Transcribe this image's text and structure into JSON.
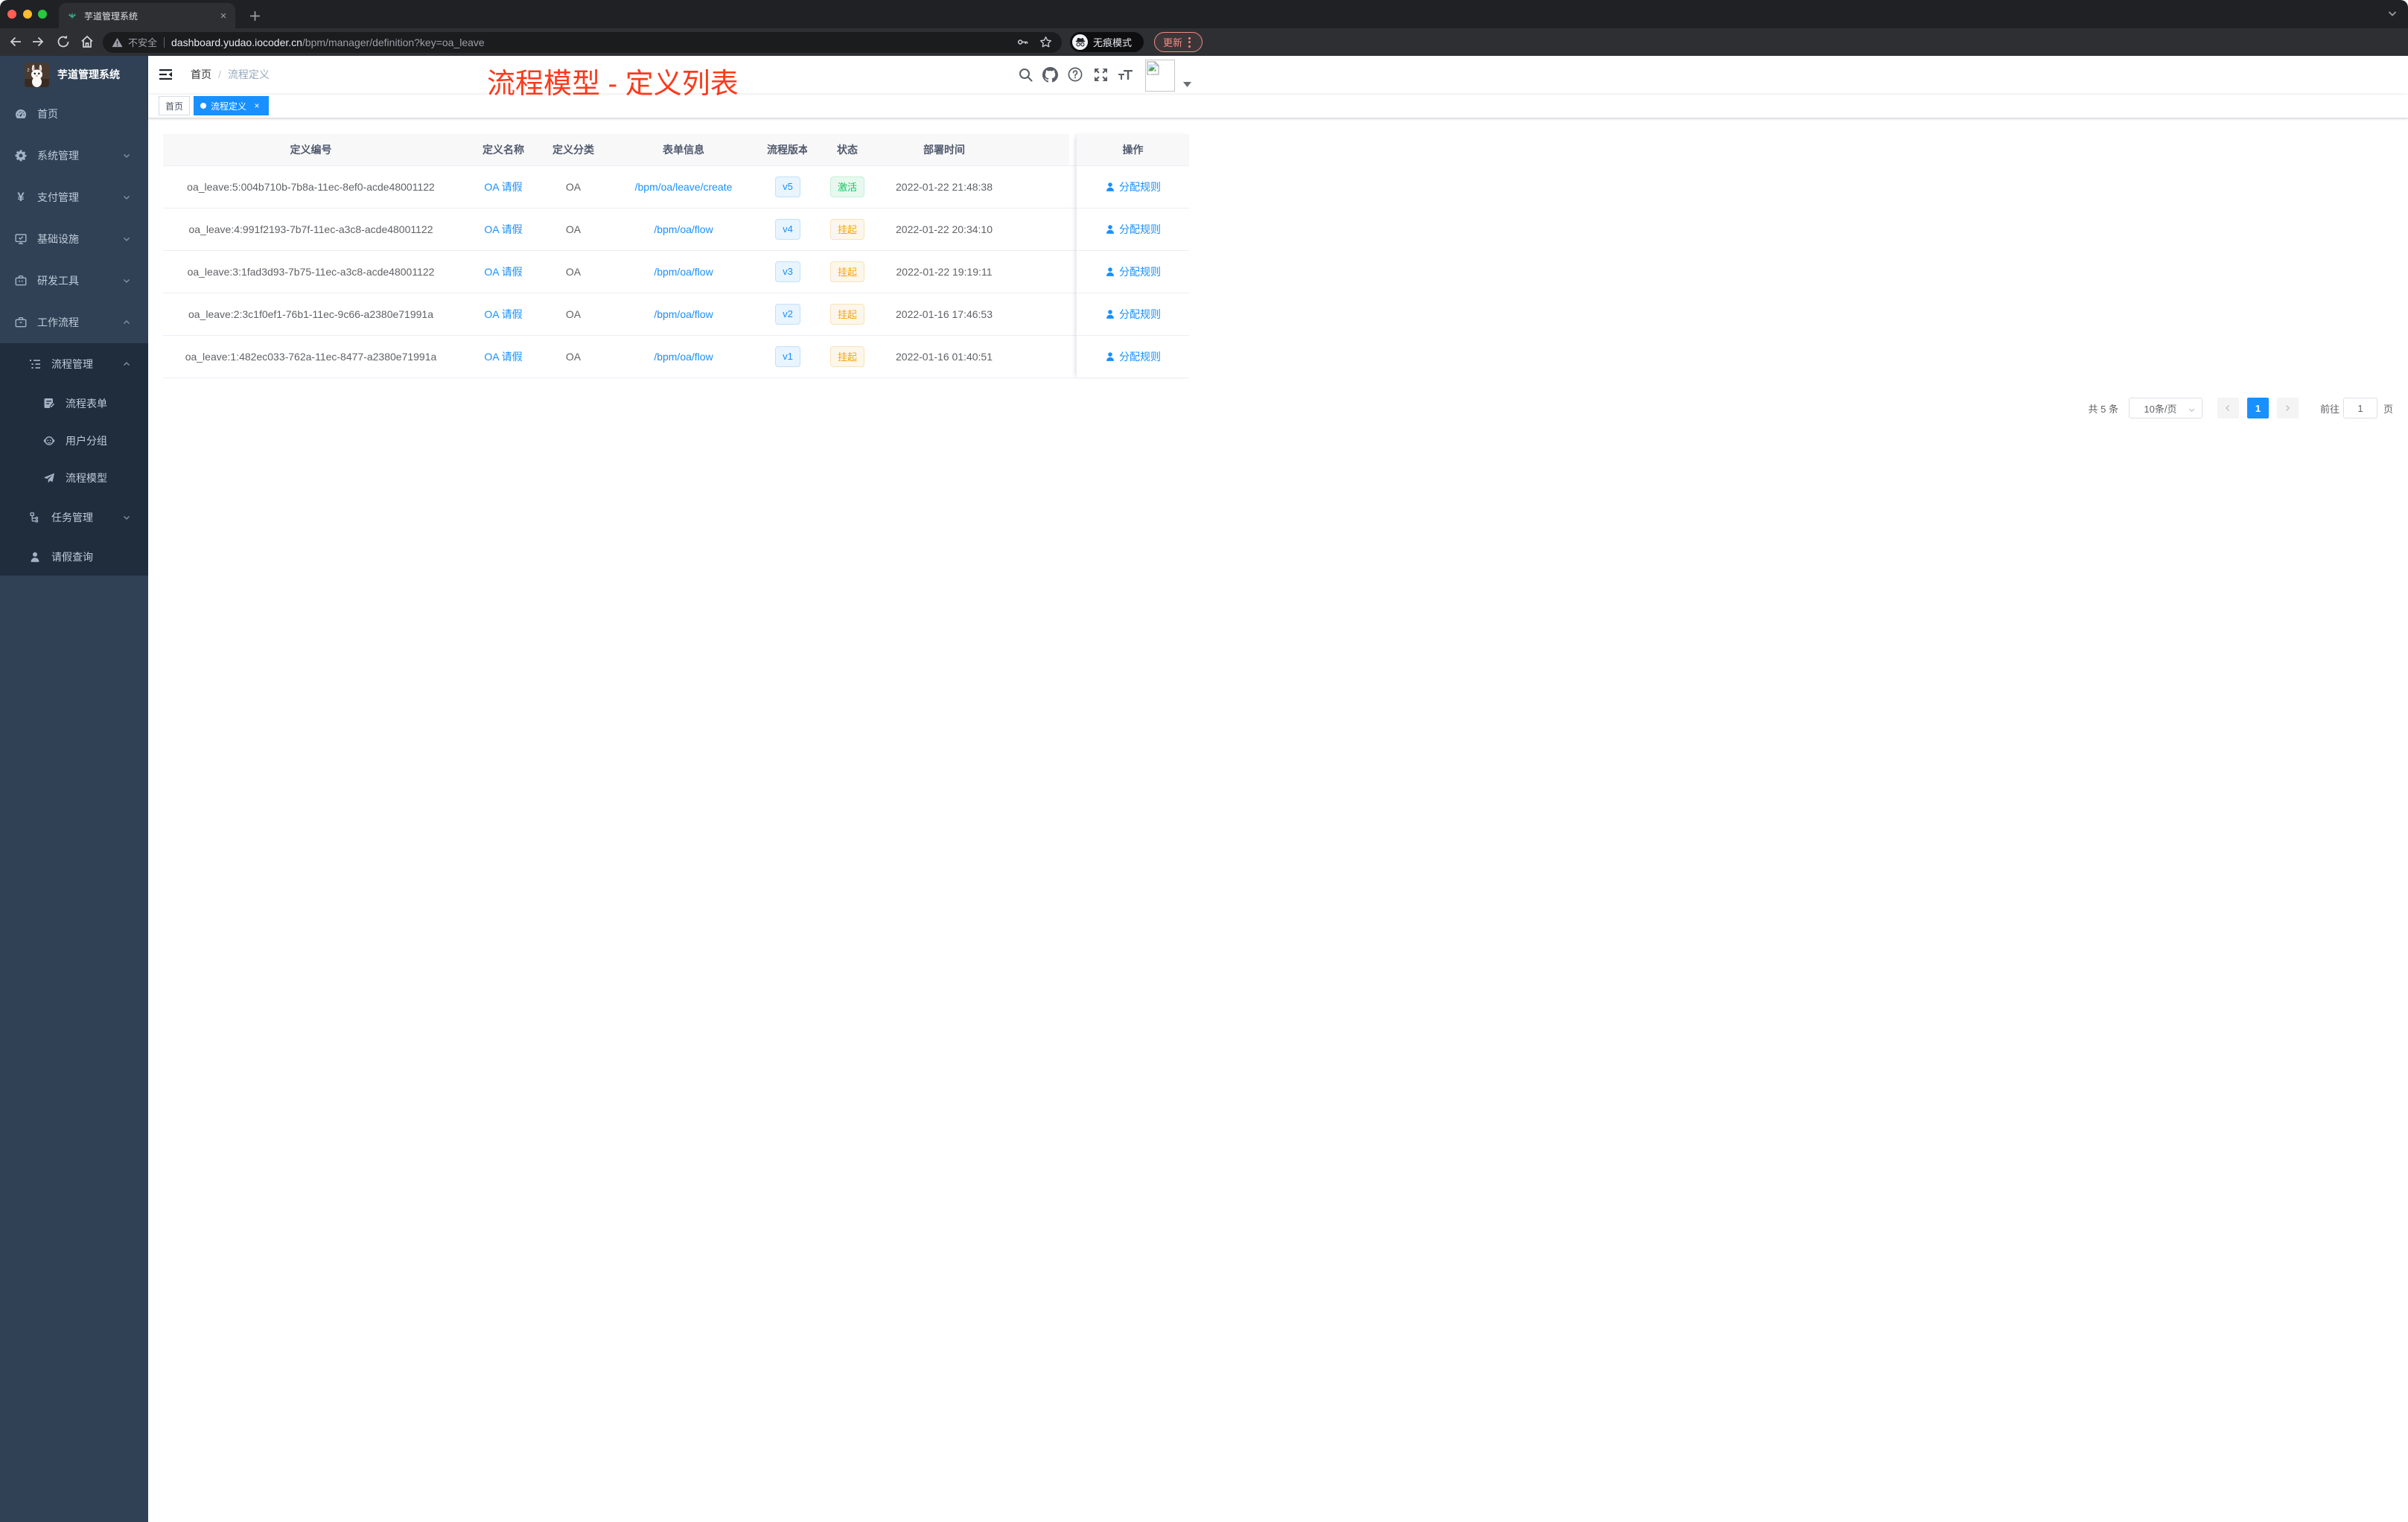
{
  "browser": {
    "tab_title": "芋道管理系统",
    "new_tab_symbol": "+",
    "close_tab_symbol": "×",
    "address": {
      "warning_label": "不安全",
      "domain": "dashboard.yudao.iocoder.cn",
      "path": "/bpm/manager/definition?key=oa_leave"
    },
    "incognito_label": "无痕模式",
    "update_label": "更新"
  },
  "sidebar": {
    "logo_title": "芋道管理系统",
    "items": [
      {
        "label": "首页",
        "icon": "dashboard-icon"
      },
      {
        "label": "系统管理",
        "icon": "gear-icon",
        "arrow": "down"
      },
      {
        "label": "支付管理",
        "icon": "yen-icon",
        "arrow": "down",
        "yen": "¥"
      },
      {
        "label": "基础设施",
        "icon": "monitor-icon",
        "arrow": "down"
      },
      {
        "label": "研发工具",
        "icon": "toolbox-icon",
        "arrow": "down"
      },
      {
        "label": "工作流程",
        "icon": "briefcase-icon",
        "arrow": "up"
      },
      {
        "label": "流程管理",
        "icon": "list-tree-icon",
        "arrow": "up"
      },
      {
        "label": "流程表单",
        "icon": "form-edit-icon"
      },
      {
        "label": "用户分组",
        "icon": "user-group-icon"
      },
      {
        "label": "流程模型",
        "icon": "paper-plane-icon"
      },
      {
        "label": "任务管理",
        "icon": "org-node-icon",
        "arrow": "down"
      },
      {
        "label": "请假查询",
        "icon": "person-icon"
      }
    ]
  },
  "navbar": {
    "breadcrumb": {
      "first": "首页",
      "separator": "/",
      "current": "流程定义"
    }
  },
  "tags": [
    {
      "label": "首页",
      "state": ""
    },
    {
      "label": "流程定义",
      "state": "active",
      "close_symbol": "×"
    }
  ],
  "annotation": "流程模型 - 定义列表",
  "table": {
    "columns": [
      "定义编号",
      "定义名称",
      "定义分类",
      "表单信息",
      "流程版本",
      "状态",
      "部署时间",
      "操作"
    ],
    "rows": [
      {
        "id": "oa_leave:5:004b710b-7b8a-11ec-8ef0-acde48001122",
        "name": "OA 请假",
        "category": "OA",
        "form": "/bpm/oa/leave/create",
        "version": "v5",
        "status": "激活",
        "status_type": "success",
        "time": "2022-01-22 21:48:38",
        "action": "分配规则"
      },
      {
        "id": "oa_leave:4:991f2193-7b7f-11ec-a3c8-acde48001122",
        "name": "OA 请假",
        "category": "OA",
        "form": "/bpm/oa/flow",
        "version": "v4",
        "status": "挂起",
        "status_type": "warning",
        "time": "2022-01-22 20:34:10",
        "action": "分配规则"
      },
      {
        "id": "oa_leave:3:1fad3d93-7b75-11ec-a3c8-acde48001122",
        "name": "OA 请假",
        "category": "OA",
        "form": "/bpm/oa/flow",
        "version": "v3",
        "status": "挂起",
        "status_type": "warning",
        "time": "2022-01-22 19:19:11",
        "action": "分配规则"
      },
      {
        "id": "oa_leave:2:3c1f0ef1-76b1-11ec-9c66-a2380e71991a",
        "name": "OA 请假",
        "category": "OA",
        "form": "/bpm/oa/flow",
        "version": "v2",
        "status": "挂起",
        "status_type": "warning",
        "time": "2022-01-16 17:46:53",
        "action": "分配规则"
      },
      {
        "id": "oa_leave:1:482ec033-762a-11ec-8477-a2380e71991a",
        "name": "OA 请假",
        "category": "OA",
        "form": "/bpm/oa/flow",
        "version": "v1",
        "status": "挂起",
        "status_type": "warning",
        "time": "2022-01-16 01:40:51",
        "action": "分配规则"
      }
    ]
  },
  "pagination": {
    "total_label": "共 5 条",
    "page_size_label": "10条/页",
    "current_page": "1",
    "goto_label": "前往",
    "goto_value": "1",
    "unit_label": "页"
  },
  "colors": {
    "accent_blue": "#1890ff",
    "success_green": "#12c565",
    "warning_orange": "#f8a412",
    "sidebar_bg": "#304156",
    "sidebar_sub_bg": "#1f2d3d",
    "annotation_red": "#fb3a1c",
    "update_salmon": "#f28b82"
  }
}
